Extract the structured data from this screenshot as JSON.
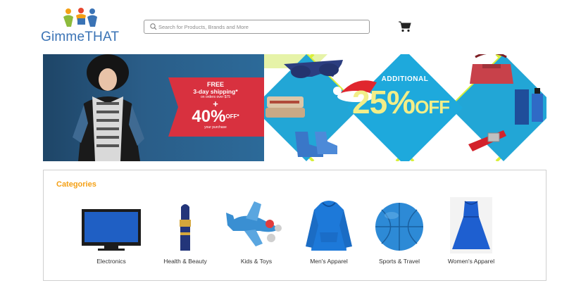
{
  "header": {
    "logo_text": "GimmeTHAT",
    "search_placeholder": "Search for Products, Brands and More",
    "icons": [
      "gimmethat-logo-icon",
      "search-icon",
      "cart-icon"
    ]
  },
  "banner_left": {
    "free": "FREE",
    "shipping": "3-day shipping*",
    "on_orders": "on orders over $75",
    "plus": "+",
    "percent": "40%",
    "off": "OFF*",
    "your_purchase": "your purchase"
  },
  "banner_right": {
    "additional": "ADDITIONAL",
    "percent": "25%",
    "off": "OFF",
    "colors": {
      "teal": "#22a6d6",
      "lime": "#d9ef3a",
      "yellow_text": "#f2ee88"
    }
  },
  "categories": {
    "title": "Categories",
    "items": [
      {
        "label": "Electronics",
        "icon": "tv-icon"
      },
      {
        "label": "Health & Beauty",
        "icon": "lipstick-icon"
      },
      {
        "label": "Kids & Toys",
        "icon": "toy-airplane-icon"
      },
      {
        "label": "Men's Apparel",
        "icon": "hoodie-icon"
      },
      {
        "label": "Sports & Travel",
        "icon": "ball-icon"
      },
      {
        "label": "Women's Apparel",
        "icon": "dress-icon"
      }
    ]
  },
  "colors": {
    "brand_blue": "#3a73b5",
    "accent_orange": "#f4a015",
    "promo_red": "#d8313f"
  }
}
